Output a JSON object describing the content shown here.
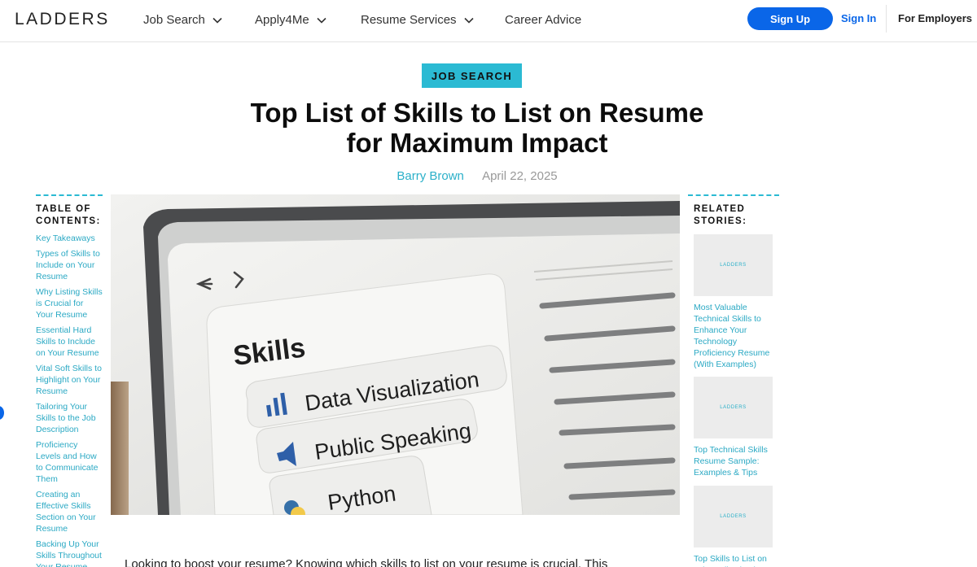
{
  "header": {
    "logo": "LADDERS",
    "nav": [
      "Job Search",
      "Apply4Me",
      "Resume Services",
      "Career Advice"
    ],
    "signup_label": "Sign Up",
    "signin_label": "Sign In",
    "employers_label": "For Employers"
  },
  "article": {
    "category": "JOB SEARCH",
    "title_line1": "Top List of Skills to List on Resume",
    "title_line2": "for Maximum Impact",
    "author": "Barry Brown",
    "date": "April 22, 2025",
    "intro": "Looking to boost your resume? Knowing which skills to list on your resume is crucial. This"
  },
  "hero": {
    "heading": "Skills",
    "pills": [
      "Data Visualization",
      "Public Speaking",
      "Python"
    ]
  },
  "toc": {
    "heading": "TABLE OF CONTENTS:",
    "items": [
      "Key Takeaways",
      "Types of Skills to Include on Your Resume",
      "Why Listing Skills is Crucial for Your Resume",
      "Essential Hard Skills to Include on Your Resume",
      "Vital Soft Skills to Highlight on Your Resume",
      "Tailoring Your Skills to the Job Description",
      "Proficiency Levels and How to Communicate Them",
      "Creating an Effective Skills Section on Your Resume",
      "Backing Up Your Skills Throughout Your Resume"
    ]
  },
  "related": {
    "heading": "RELATED STORIES:",
    "thumb_label": "LADDERS",
    "stories": [
      "Most Valuable Technical Skills to Enhance Your Technology Proficiency Resume (With Examples)",
      "Top Technical Skills Resume Sample: Examples & Tips",
      "Top Skills to List on Job Application in"
    ]
  }
}
